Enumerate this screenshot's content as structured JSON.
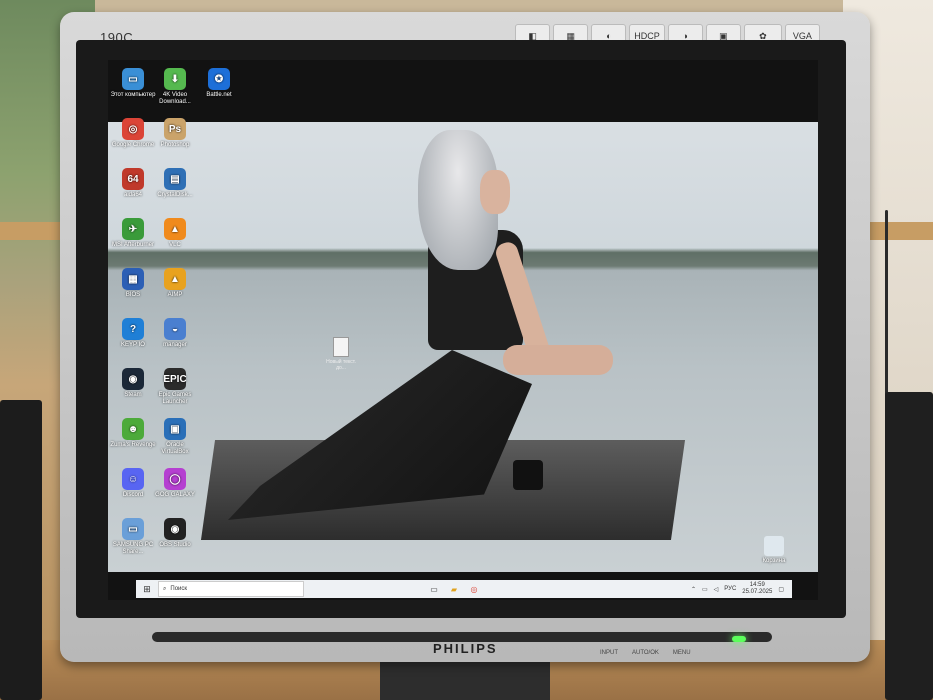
{
  "monitor": {
    "model": "190C",
    "brand": "PHILIPS",
    "badges": [
      {
        "label": "SmartImage",
        "icon": "smartimage-icon",
        "glyph": "◧"
      },
      {
        "label": "SmartContrast",
        "icon": "smartcontrast-icon",
        "glyph": "▦"
      },
      {
        "label": "Srrs",
        "icon": "srrs-icon",
        "glyph": "◐"
      },
      {
        "label": "HDCP ready",
        "icon": "hdcp-icon",
        "glyph": "HDCP"
      },
      {
        "label": "Perfectune",
        "icon": "perfectune-icon",
        "glyph": "◑"
      },
      {
        "label": "SmartControl",
        "icon": "smartcontrol-icon",
        "glyph": "▣"
      },
      {
        "label": "FlameRetardant",
        "icon": "flame-retardant-icon",
        "glyph": "✿"
      },
      {
        "label": "Dualinput",
        "icon": "dualinput-icon",
        "glyph": "VGA"
      }
    ],
    "controls": [
      "INPUT",
      "AUTO/OK",
      "MENU"
    ],
    "power_color": "#5bff5b"
  },
  "desktop": {
    "icons": [
      {
        "label": "Этот компьютер",
        "glyph": "▭",
        "color": "#3a8fd6"
      },
      {
        "label": "4K Video Download...",
        "glyph": "⬇",
        "color": "#55b94f"
      },
      {
        "label": "Battle.net",
        "glyph": "✪",
        "color": "#1d6fd8"
      },
      {
        "label": "Google Chrome",
        "glyph": "◎",
        "color": "#db4437"
      },
      {
        "label": "Photoshop",
        "glyph": "Ps",
        "color": "#caa36a"
      },
      {
        "label": "aida64",
        "glyph": "64",
        "color": "#c0392b"
      },
      {
        "label": "CrystalDisk...",
        "glyph": "▤",
        "color": "#2e6fb5"
      },
      {
        "label": "MSI Afterburner",
        "glyph": "✈",
        "color": "#3a9b3a"
      },
      {
        "label": "VLC",
        "glyph": "▲",
        "color": "#f08a1c"
      },
      {
        "label": "BIOS",
        "glyph": "▦",
        "color": "#2c5fb5"
      },
      {
        "label": "AIMP",
        "glyph": "▲",
        "color": "#e8a21f"
      },
      {
        "label": "KEYP IO",
        "glyph": "?",
        "color": "#1f7fd6"
      },
      {
        "label": "manager",
        "glyph": "◒",
        "color": "#4a7fd0"
      },
      {
        "label": "Steam",
        "glyph": "◉",
        "color": "#1b2838"
      },
      {
        "label": "Epic Games Launcher",
        "glyph": "EPIC",
        "color": "#2b2b2b"
      },
      {
        "label": "Zuma's Revenge",
        "glyph": "☻",
        "color": "#4caa3a"
      },
      {
        "label": "Oracle VirtualBox",
        "glyph": "▣",
        "color": "#2a6fb8"
      },
      {
        "label": "Discord",
        "glyph": "☺",
        "color": "#5865f2"
      },
      {
        "label": "GOG GALAXY",
        "glyph": "◯",
        "color": "#b53fd1"
      },
      {
        "label": "SAMSUNG PC Share...",
        "glyph": "▭",
        "color": "#6a9fd8"
      },
      {
        "label": "OBS Studio",
        "glyph": "◉",
        "color": "#222222"
      }
    ],
    "file_label": "Новый текст. до...",
    "recycle_label": "Корзина"
  },
  "taskbar": {
    "search_placeholder": "Поиск",
    "lang": "РУС",
    "time": "14:59",
    "date": "25.07.2025"
  }
}
